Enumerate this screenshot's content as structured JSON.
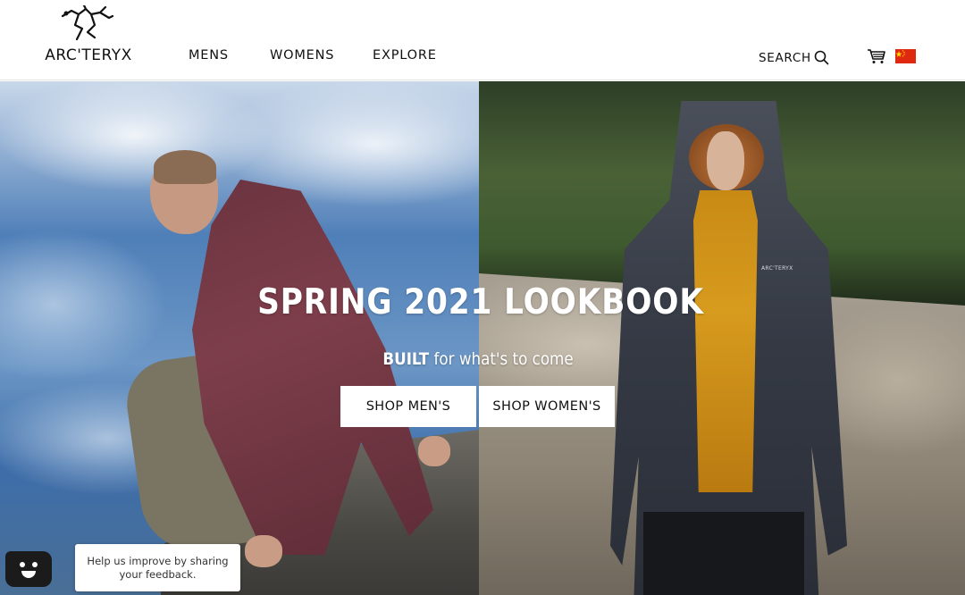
{
  "header": {
    "logo_text": "ARC'TERYX",
    "nav": {
      "mens": "MENS",
      "womens": "WOMENS",
      "explore": "EXPLORE"
    },
    "search_label": "SEARCH",
    "icons": [
      "arcteryx-bird-logo-icon",
      "search-icon",
      "cart-icon",
      "china-flag-icon"
    ],
    "flag_color": "#de2910"
  },
  "hero": {
    "headline": "SPRING 2021 LOOKBOOK",
    "tagline_bold": "BUILT",
    "tagline_rest": " for what's to come",
    "shop_mens": "SHOP MEN'S",
    "shop_womens": "SHOP WOMEN'S",
    "jacket_logo": "ARC'TERYX"
  },
  "feedback": {
    "message": "Help us improve by sharing your feedback.",
    "icon": "smiley-face-icon"
  }
}
